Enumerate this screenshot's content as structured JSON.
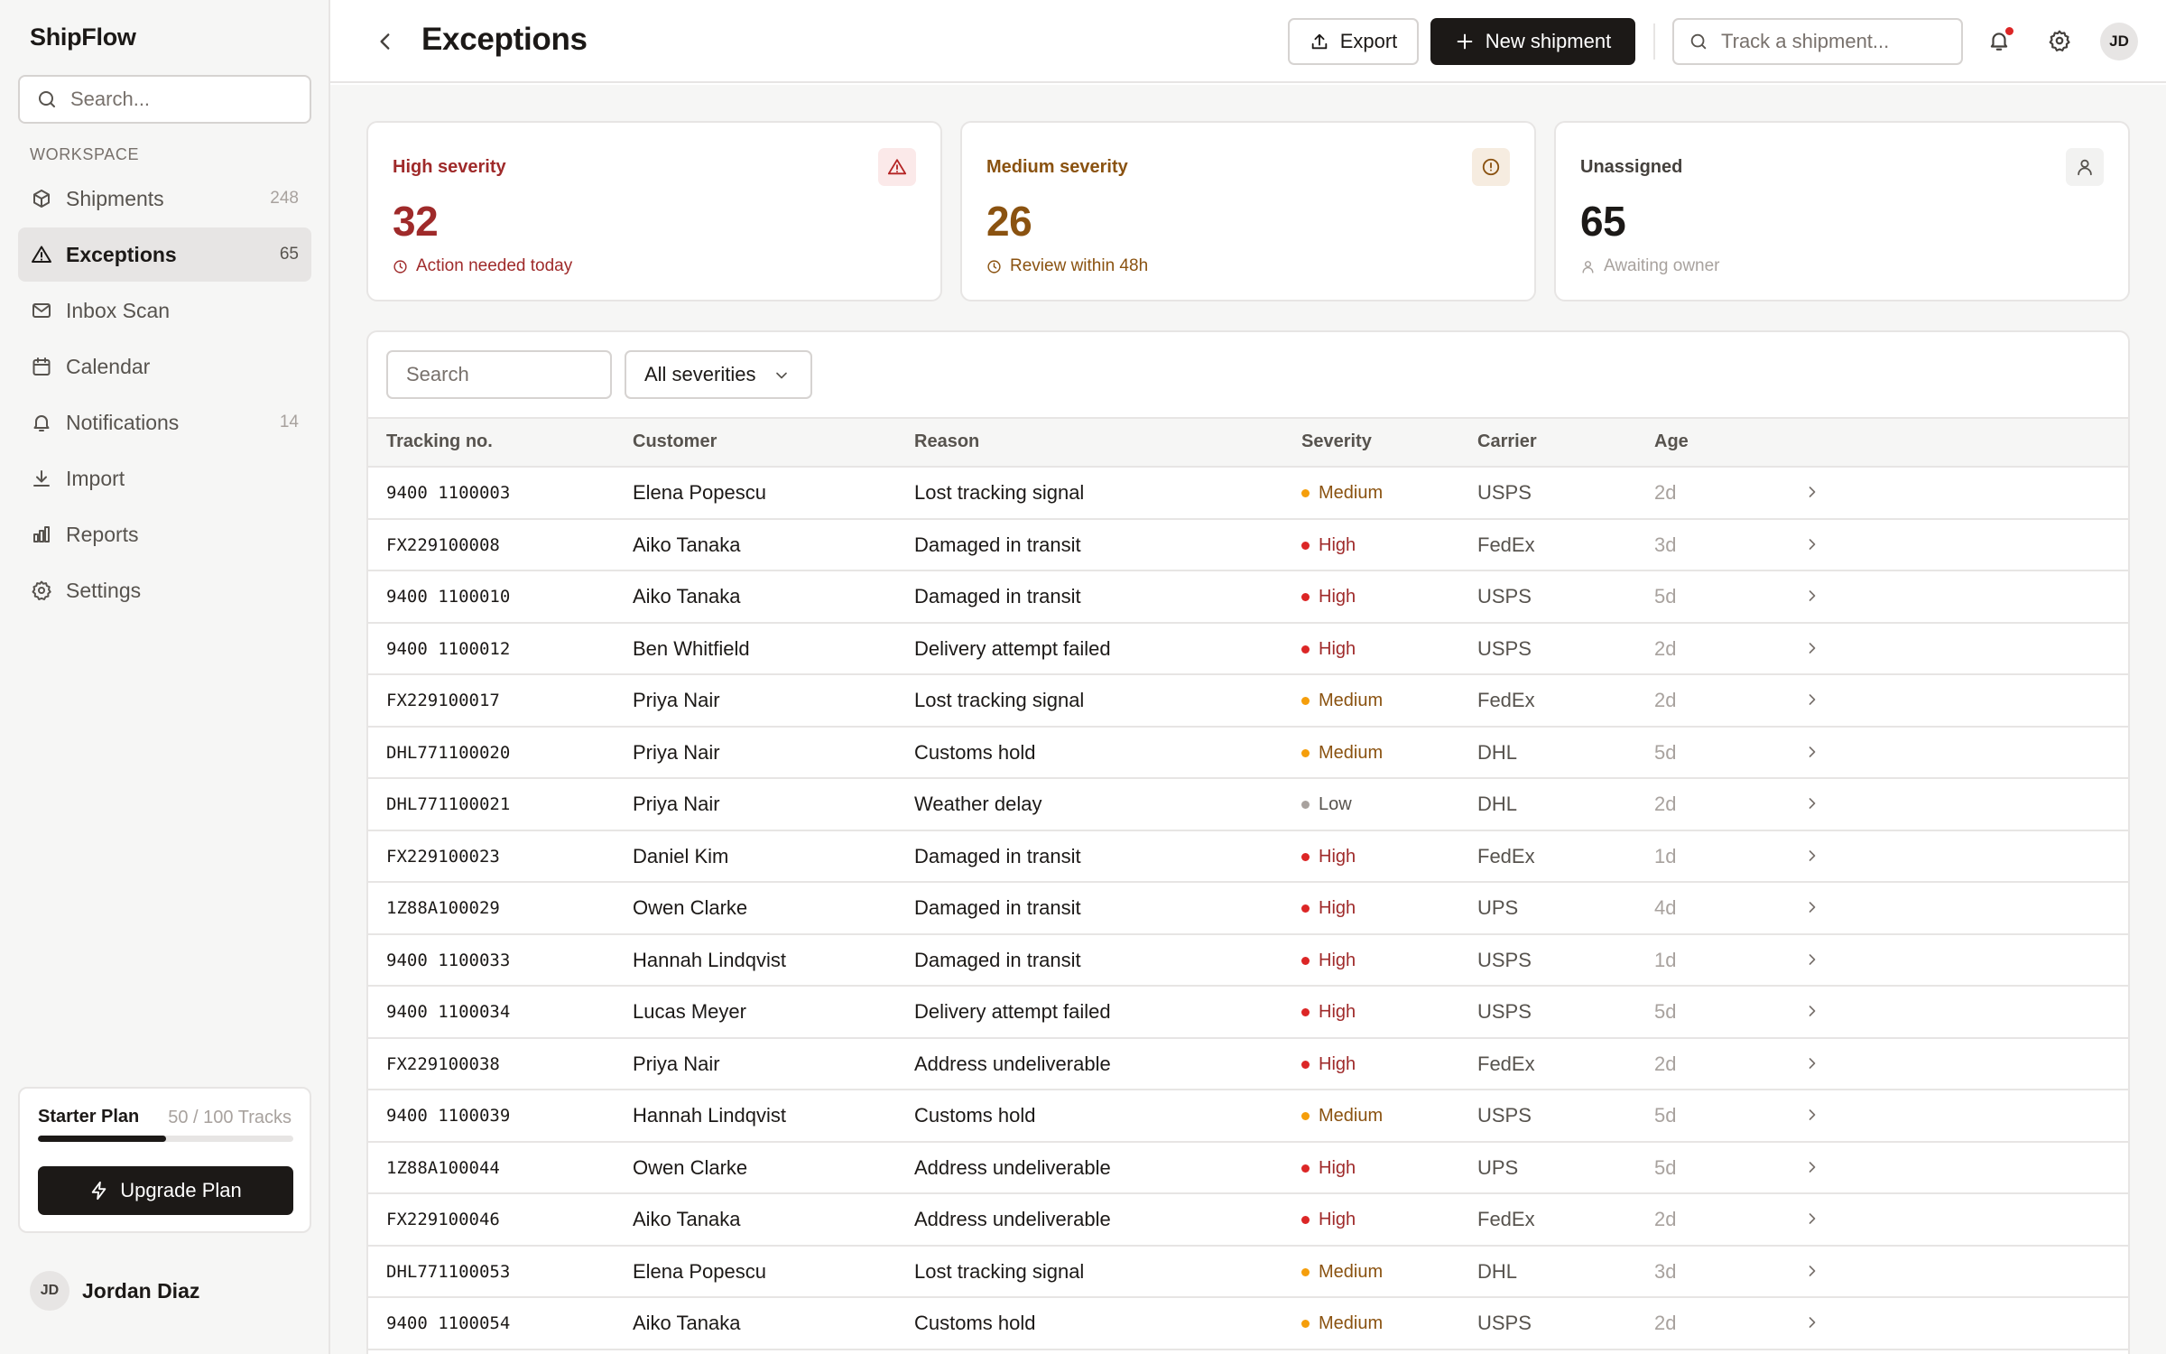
{
  "app": {
    "name": "ShipFlow"
  },
  "sidebar": {
    "search_placeholder": "Search...",
    "section_label": "WORKSPACE",
    "items": [
      {
        "label": "Shipments",
        "count": "248",
        "icon": "package-icon"
      },
      {
        "label": "Exceptions",
        "count": "65",
        "icon": "alert-triangle-icon",
        "active": true
      },
      {
        "label": "Inbox Scan",
        "count": "",
        "icon": "mail-icon"
      },
      {
        "label": "Calendar",
        "count": "",
        "icon": "calendar-icon"
      },
      {
        "label": "Notifications",
        "count": "14",
        "icon": "bell-icon"
      },
      {
        "label": "Import",
        "count": "",
        "icon": "download-icon"
      },
      {
        "label": "Reports",
        "count": "",
        "icon": "bar-chart-icon"
      },
      {
        "label": "Settings",
        "count": "",
        "icon": "gear-icon"
      }
    ],
    "plan": {
      "name": "Starter Plan",
      "usage": "50 / 100 Tracks",
      "progress": 0.5,
      "upgrade_label": "Upgrade Plan"
    },
    "user": {
      "initials": "JD",
      "name": "Jordan Diaz"
    }
  },
  "header": {
    "title": "Exceptions",
    "export_label": "Export",
    "new_label": "New shipment",
    "track_placeholder": "Track a shipment...",
    "avatar_initials": "JD"
  },
  "cards": [
    {
      "label": "High severity",
      "value": "32",
      "sub": "Action needed today",
      "color": "#9f2a2a",
      "icon_bg": "#fbe9e9",
      "icon": "alert-triangle-icon",
      "sub_icon": "clock-icon"
    },
    {
      "label": "Medium severity",
      "value": "26",
      "sub": "Review within 48h",
      "color": "#8a5210",
      "icon_bg": "#f6ece0",
      "icon": "alert-circle-icon",
      "sub_icon": "clock-icon"
    },
    {
      "label": "Unassigned",
      "value": "65",
      "sub": "Awaiting owner",
      "color": "#1c1917",
      "icon_bg": "#f2f2f1",
      "icon": "user-icon",
      "sub_icon": "user-icon"
    }
  ],
  "filters": {
    "search_placeholder": "Search",
    "severity": "All severities"
  },
  "table": {
    "columns": [
      "Tracking no.",
      "Customer",
      "Reason",
      "Severity",
      "Carrier",
      "Age"
    ],
    "severity_colors": {
      "High": "#dc2626",
      "Medium": "#f59e0b",
      "Low": "#a8a29e"
    },
    "severity_text_colors": {
      "High": "#9f2a2a",
      "Medium": "#8a5210",
      "Low": "#57534e"
    },
    "rows": [
      {
        "tracking": "9400 1100003",
        "customer": "Elena Popescu",
        "reason": "Lost tracking signal",
        "severity": "Medium",
        "carrier": "USPS",
        "age": "2d"
      },
      {
        "tracking": "FX229100008",
        "customer": "Aiko Tanaka",
        "reason": "Damaged in transit",
        "severity": "High",
        "carrier": "FedEx",
        "age": "3d"
      },
      {
        "tracking": "9400 1100010",
        "customer": "Aiko Tanaka",
        "reason": "Damaged in transit",
        "severity": "High",
        "carrier": "USPS",
        "age": "5d"
      },
      {
        "tracking": "9400 1100012",
        "customer": "Ben Whitfield",
        "reason": "Delivery attempt failed",
        "severity": "High",
        "carrier": "USPS",
        "age": "2d"
      },
      {
        "tracking": "FX229100017",
        "customer": "Priya Nair",
        "reason": "Lost tracking signal",
        "severity": "Medium",
        "carrier": "FedEx",
        "age": "2d"
      },
      {
        "tracking": "DHL771100020",
        "customer": "Priya Nair",
        "reason": "Customs hold",
        "severity": "Medium",
        "carrier": "DHL",
        "age": "5d"
      },
      {
        "tracking": "DHL771100021",
        "customer": "Priya Nair",
        "reason": "Weather delay",
        "severity": "Low",
        "carrier": "DHL",
        "age": "2d"
      },
      {
        "tracking": "FX229100023",
        "customer": "Daniel Kim",
        "reason": "Damaged in transit",
        "severity": "High",
        "carrier": "FedEx",
        "age": "1d"
      },
      {
        "tracking": "1Z88A100029",
        "customer": "Owen Clarke",
        "reason": "Damaged in transit",
        "severity": "High",
        "carrier": "UPS",
        "age": "4d"
      },
      {
        "tracking": "9400 1100033",
        "customer": "Hannah Lindqvist",
        "reason": "Damaged in transit",
        "severity": "High",
        "carrier": "USPS",
        "age": "1d"
      },
      {
        "tracking": "9400 1100034",
        "customer": "Lucas Meyer",
        "reason": "Delivery attempt failed",
        "severity": "High",
        "carrier": "USPS",
        "age": "5d"
      },
      {
        "tracking": "FX229100038",
        "customer": "Priya Nair",
        "reason": "Address undeliverable",
        "severity": "High",
        "carrier": "FedEx",
        "age": "2d"
      },
      {
        "tracking": "9400 1100039",
        "customer": "Hannah Lindqvist",
        "reason": "Customs hold",
        "severity": "Medium",
        "carrier": "USPS",
        "age": "5d"
      },
      {
        "tracking": "1Z88A100044",
        "customer": "Owen Clarke",
        "reason": "Address undeliverable",
        "severity": "High",
        "carrier": "UPS",
        "age": "5d"
      },
      {
        "tracking": "FX229100046",
        "customer": "Aiko Tanaka",
        "reason": "Address undeliverable",
        "severity": "High",
        "carrier": "FedEx",
        "age": "2d"
      },
      {
        "tracking": "DHL771100053",
        "customer": "Elena Popescu",
        "reason": "Lost tracking signal",
        "severity": "Medium",
        "carrier": "DHL",
        "age": "3d"
      },
      {
        "tracking": "9400 1100054",
        "customer": "Aiko Tanaka",
        "reason": "Customs hold",
        "severity": "Medium",
        "carrier": "USPS",
        "age": "2d"
      }
    ]
  }
}
